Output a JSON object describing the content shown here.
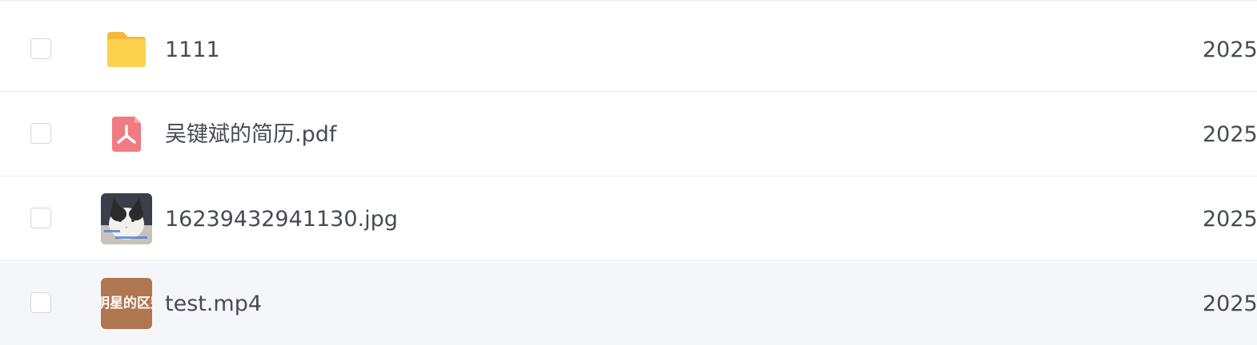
{
  "files": [
    {
      "name": "1111",
      "type_icon": "folder-icon",
      "date": "2025"
    },
    {
      "name": "吴键斌的简历.pdf",
      "type_icon": "pdf-icon",
      "date": "2025"
    },
    {
      "name": "16239432941130.jpg",
      "type_icon": "image-thumbnail",
      "date": "2025"
    },
    {
      "name": "test.mp4",
      "type_icon": "video-thumbnail",
      "date": "2025",
      "thumbnail_text": "明星的区别"
    }
  ],
  "colors": {
    "folder": "#fcd24d",
    "pdf": "#f07b82",
    "video_thumb": "#b0764f",
    "hover_row": "#f5f6fa",
    "text": "#454a55",
    "divider": "#ebebed"
  }
}
